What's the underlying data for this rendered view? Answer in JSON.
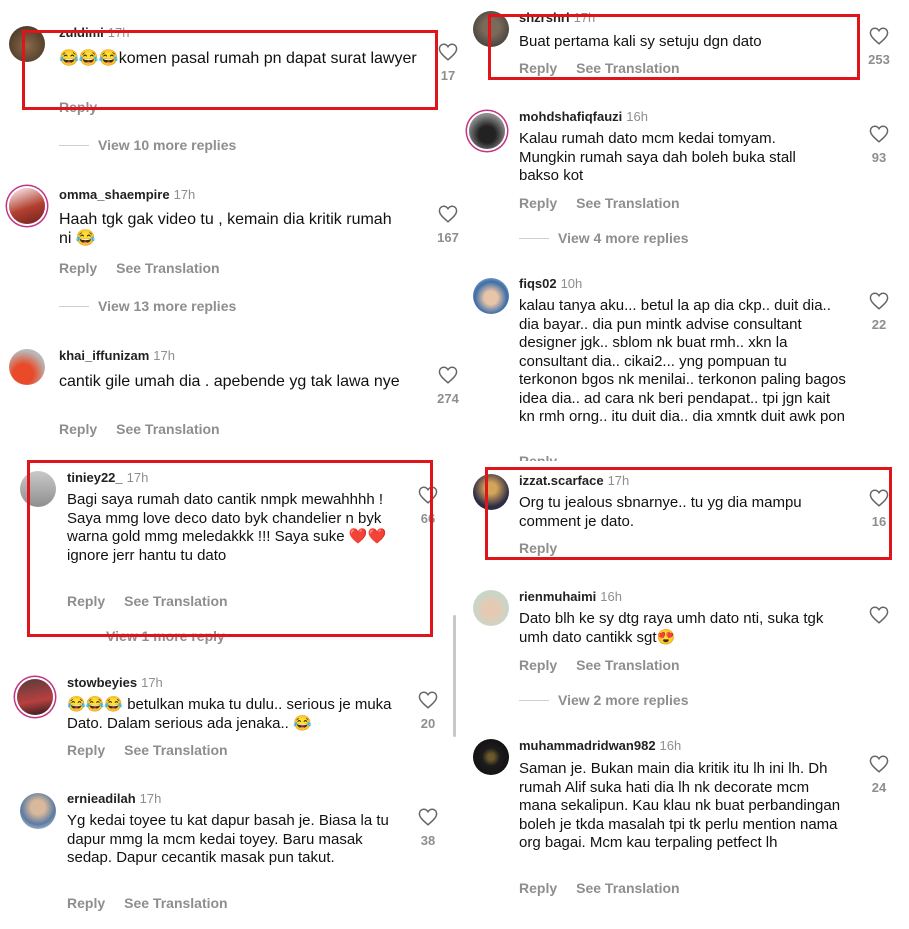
{
  "ui": {
    "reply_label": "Reply",
    "translate_label": "See Translation"
  },
  "left": [
    {
      "user": "zuldimi",
      "time": "17h",
      "text": "😂😂😂komen pasal rumah pn dapat surat lawyer",
      "likes": "17",
      "reply": "Reply",
      "view_more": "View 10 more replies",
      "highlight": true
    },
    {
      "user": "omma_shaempire",
      "time": "17h",
      "text": "Haah tgk gak video tu , kemain dia kritik rumah ni 😂",
      "likes": "167",
      "view_more": "View 13 more replies"
    },
    {
      "user": "khai_iffunizam",
      "time": "17h",
      "text": "cantik gile umah dia . apebende yg tak lawa nye",
      "likes": "274"
    },
    {
      "user": "tiniey22_",
      "time": "17h",
      "text": "Bagi saya rumah dato cantik nmpk mewahhhh ! Saya mmg love deco dato byk chandelier n byk warna gold mmg meledakkk !!! Saya suke ❤️❤️ ignore jerr hantu tu dato",
      "likes": "66",
      "view_more": "View 1 more reply",
      "highlight": true
    },
    {
      "user": "stowbeyies",
      "time": "17h",
      "text": "😂😂😂 betulkan muka tu dulu.. serious je muka Dato. Dalam serious ada jenaka.. 😂",
      "likes": "20"
    },
    {
      "user": "ernieadilah",
      "time": "17h",
      "text": "Yg kedai toyee tu kat dapur basah je. Biasa la tu dapur mmg la mcm kedai toyey. Baru masak sedap. Dapur cecantik masak pun takut.",
      "likes": "38"
    }
  ],
  "right": [
    {
      "user": "shzrshrl",
      "time": "17h",
      "text": "Buat pertama kali sy setuju dgn dato",
      "likes": "253",
      "highlight": true
    },
    {
      "user": "mohdshafiqfauzi",
      "time": "16h",
      "text": "Kalau rumah dato mcm kedai tomyam. Mungkin rumah saya dah boleh buka stall bakso kot",
      "likes": "93",
      "view_more": "View 4 more replies"
    },
    {
      "user": "fiqs02",
      "time": "10h",
      "text": "kalau tanya aku... betul la ap dia ckp.. duit dia.. dia bayar.. dia pun mintk advise consultant designer jgk.. sblom nk buat rmh.. xkn la consultant dia.. cikai2... yng pompuan tu terkonon bgos nk menilai.. terkonon paling bagos idea dia.. ad cara nk beri pendapat.. tpi jgn kait kn rmh orng.. itu duit dia.. dia xmntk duit awk pon",
      "likes": "22",
      "reply": "Reply"
    },
    {
      "user": "izzat.scarface",
      "time": "17h",
      "text": "Org tu jealous sbnarnye.. tu yg dia mampu comment je dato.",
      "likes": "16",
      "highlight": true
    },
    {
      "user": "rienmuhaimi",
      "time": "16h",
      "text": "Dato blh ke sy dtg raya umh dato nti, suka tgk umh dato cantikk sgt😍",
      "view_more": "View 2 more replies"
    },
    {
      "user": "muhammadridwan982",
      "time": "16h",
      "text": "Saman je. Bukan main dia kritik itu lh ini lh. Dh rumah Alif suka hati dia lh nk decorate mcm mana sekalipun. Kau klau nk buat perbandingan boleh je tkda masalah tpi tk perlu mention nama org bagai. Mcm kau terpaling petfect lh",
      "likes": "24"
    }
  ],
  "colors": {
    "highlight": "#e0151b",
    "muted": "#8e8e8e",
    "story_ring": "#c13584"
  }
}
